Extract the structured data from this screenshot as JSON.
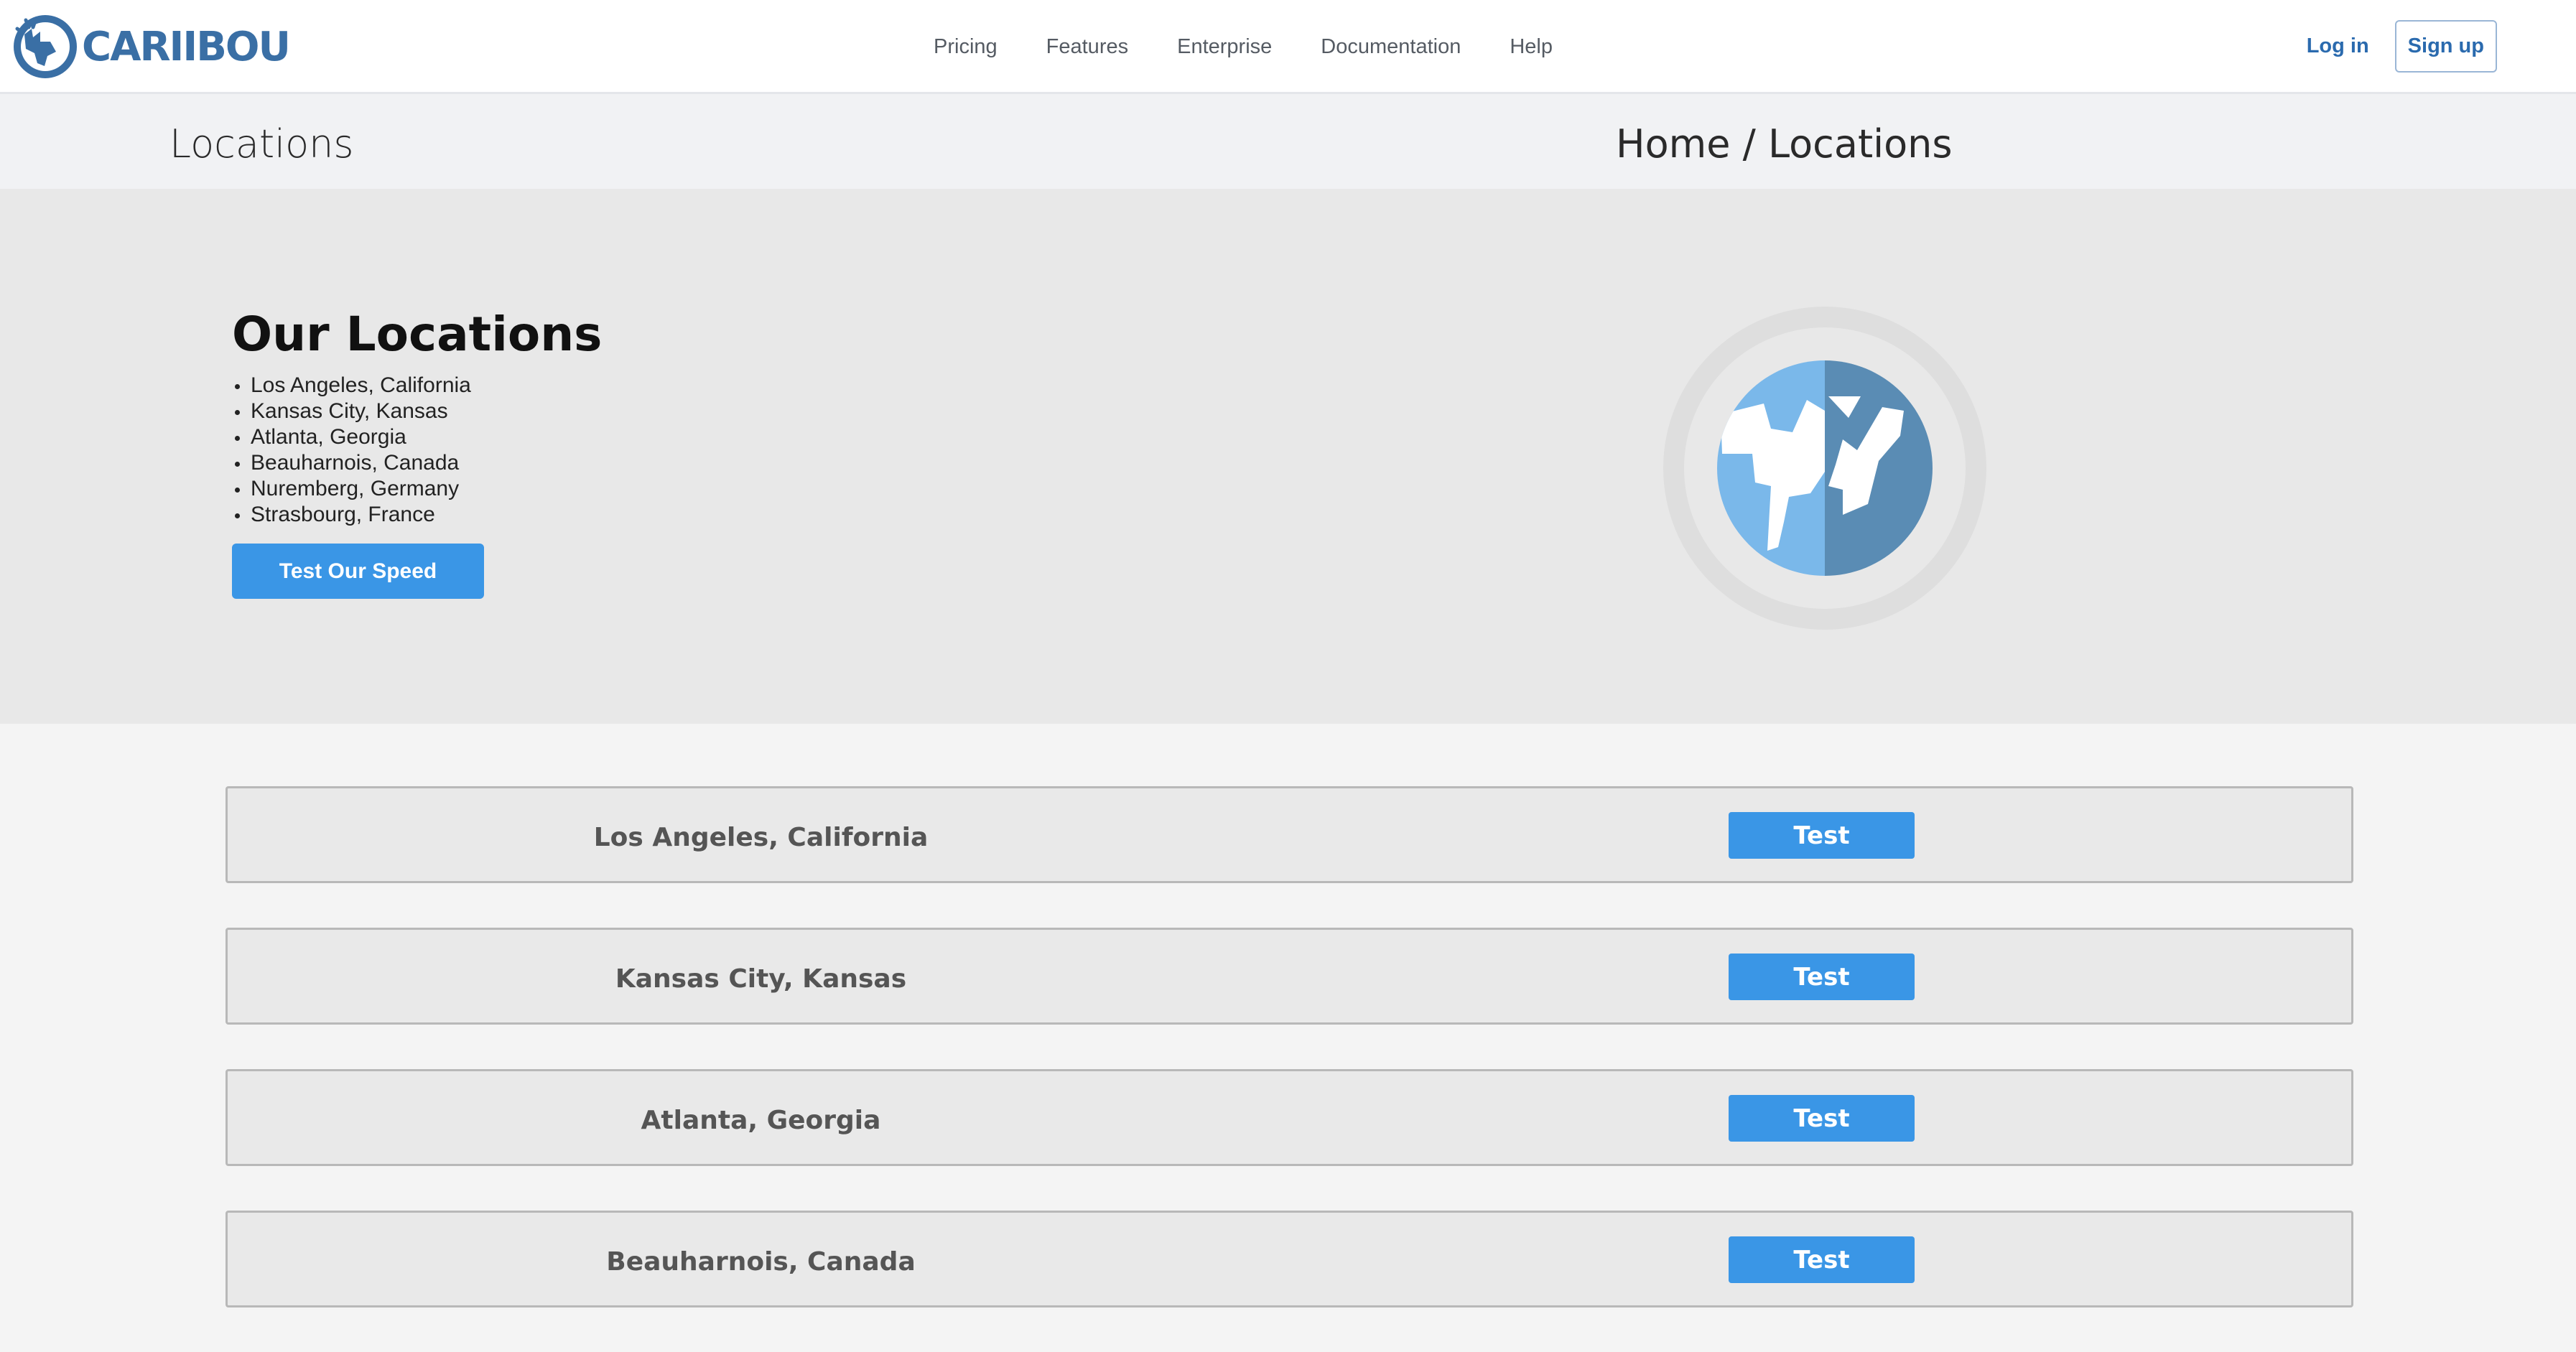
{
  "brand": {
    "name": "CARIIBOU"
  },
  "nav": {
    "links": [
      "Pricing",
      "Features",
      "Enterprise",
      "Documentation",
      "Help"
    ],
    "login": "Log in",
    "signup": "Sign up"
  },
  "breadcrumb": {
    "title": "Locations",
    "path": "Home / Locations"
  },
  "hero": {
    "title": "Our Locations",
    "locations": [
      "Los Angeles, California",
      "Kansas City, Kansas",
      "Atlanta, Georgia",
      "Beauharnois, Canada",
      "Nuremberg, Germany",
      "Strasbourg, France"
    ],
    "button": "Test Our Speed"
  },
  "rows": [
    {
      "name": "Los Angeles, California",
      "button": "Test"
    },
    {
      "name": "Kansas City, Kansas",
      "button": "Test"
    },
    {
      "name": "Atlanta, Georgia",
      "button": "Test"
    },
    {
      "name": "Beauharnois, Canada",
      "button": "Test"
    }
  ],
  "colors": {
    "brand": "#3a6fa5",
    "button": "#3a96e6",
    "globe_light": "#7ab8ea",
    "globe_dark": "#5a8cb4"
  }
}
